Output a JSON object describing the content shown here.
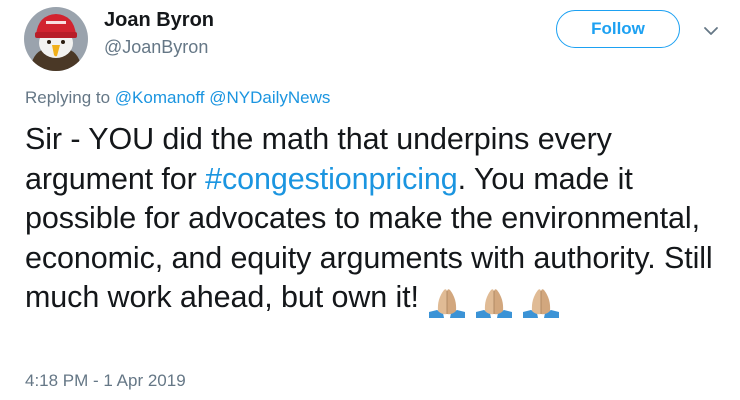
{
  "user": {
    "display_name": "Joan Byron",
    "handle": "@JoanByron",
    "avatar_icon": "eagle-with-red-hat-avatar"
  },
  "follow_button": {
    "label": "Follow",
    "color": "#1da1f2"
  },
  "menu_icon": "chevron-down-icon",
  "reply": {
    "prefix": "Replying to",
    "mentions": [
      "@Komanoff",
      "@NYDailyNews"
    ]
  },
  "tweet": {
    "text_part1": "Sir - YOU did the math that underpins every argument for",
    "hashtag": "#congestionpricing",
    "text_part2": ". You made it possible for advocates to make the environmental, economic, and equity arguments with authority. Still much work ahead, but own it!",
    "emojis": [
      "folded-hands-icon",
      "folded-hands-icon",
      "folded-hands-icon"
    ]
  },
  "timestamp": "4:18 PM - 1 Apr 2019",
  "colors": {
    "link": "#1b95e0",
    "secondary_text": "#657786",
    "primary_text": "#14171a"
  }
}
